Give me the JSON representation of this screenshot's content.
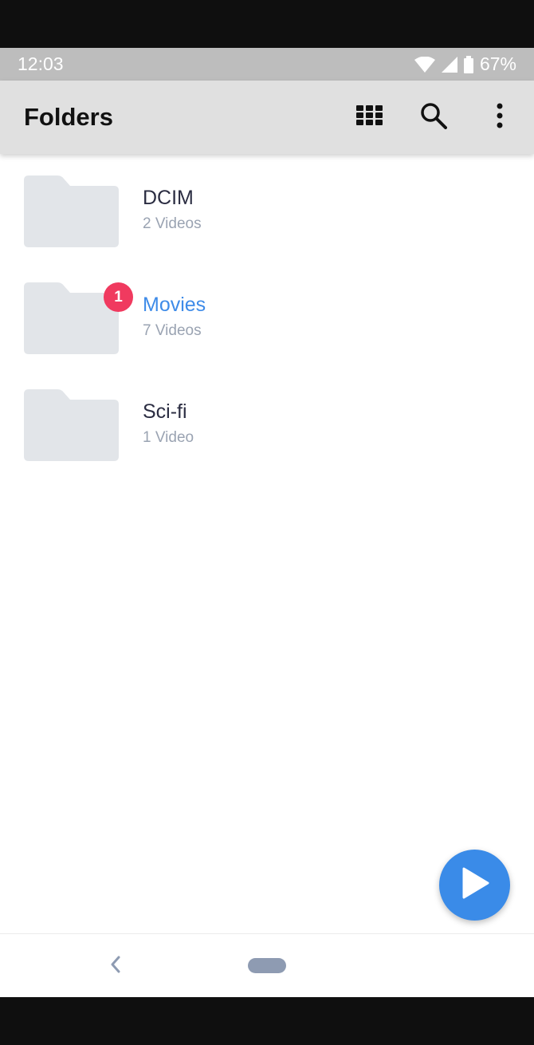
{
  "status_bar": {
    "time": "12:03",
    "battery": "67%",
    "icons": [
      "wifi-icon",
      "cell-signal-icon",
      "battery-icon"
    ]
  },
  "app_bar": {
    "title": "Folders",
    "actions": [
      "grid-view-icon",
      "search-icon",
      "more-vert-icon"
    ]
  },
  "folders": [
    {
      "name": "DCIM",
      "count": "2 Videos"
    },
    {
      "name": "Movies",
      "count": "7 Videos",
      "badge": "1",
      "highlighted": true
    },
    {
      "name": "Sci-fi",
      "count": "1 Video"
    }
  ],
  "fab": {
    "icon": "play-icon"
  },
  "nav_bar": {
    "icons": [
      "back-chevron-icon",
      "home-pill-icon"
    ]
  },
  "colors": {
    "accent": "#3e8be8",
    "badge": "#f03a5f",
    "folder_fill": "#e2e5e9",
    "app_bar_bg": "#e0e0e0",
    "status_bar_bg": "#bdbdbd",
    "subtitle_text": "#9aa3b2",
    "title_text": "#2b2d42"
  }
}
